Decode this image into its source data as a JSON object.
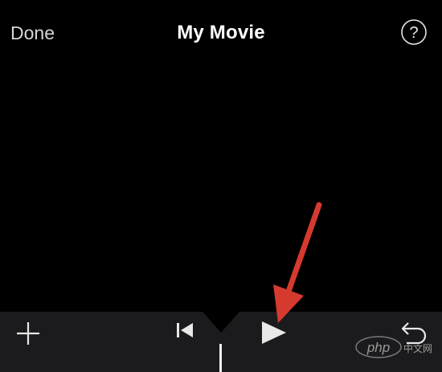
{
  "nav": {
    "done_label": "Done",
    "title": "My Movie",
    "help_glyph": "?"
  },
  "toolbar": {
    "add_icon": "plus-icon",
    "skip_icon": "skip-to-start-icon",
    "play_icon": "play-icon",
    "undo_icon": "undo-icon"
  },
  "annotation": {
    "arrow_color": "#d63a2f"
  },
  "watermark": {
    "brand": "php",
    "site": "中文网"
  }
}
